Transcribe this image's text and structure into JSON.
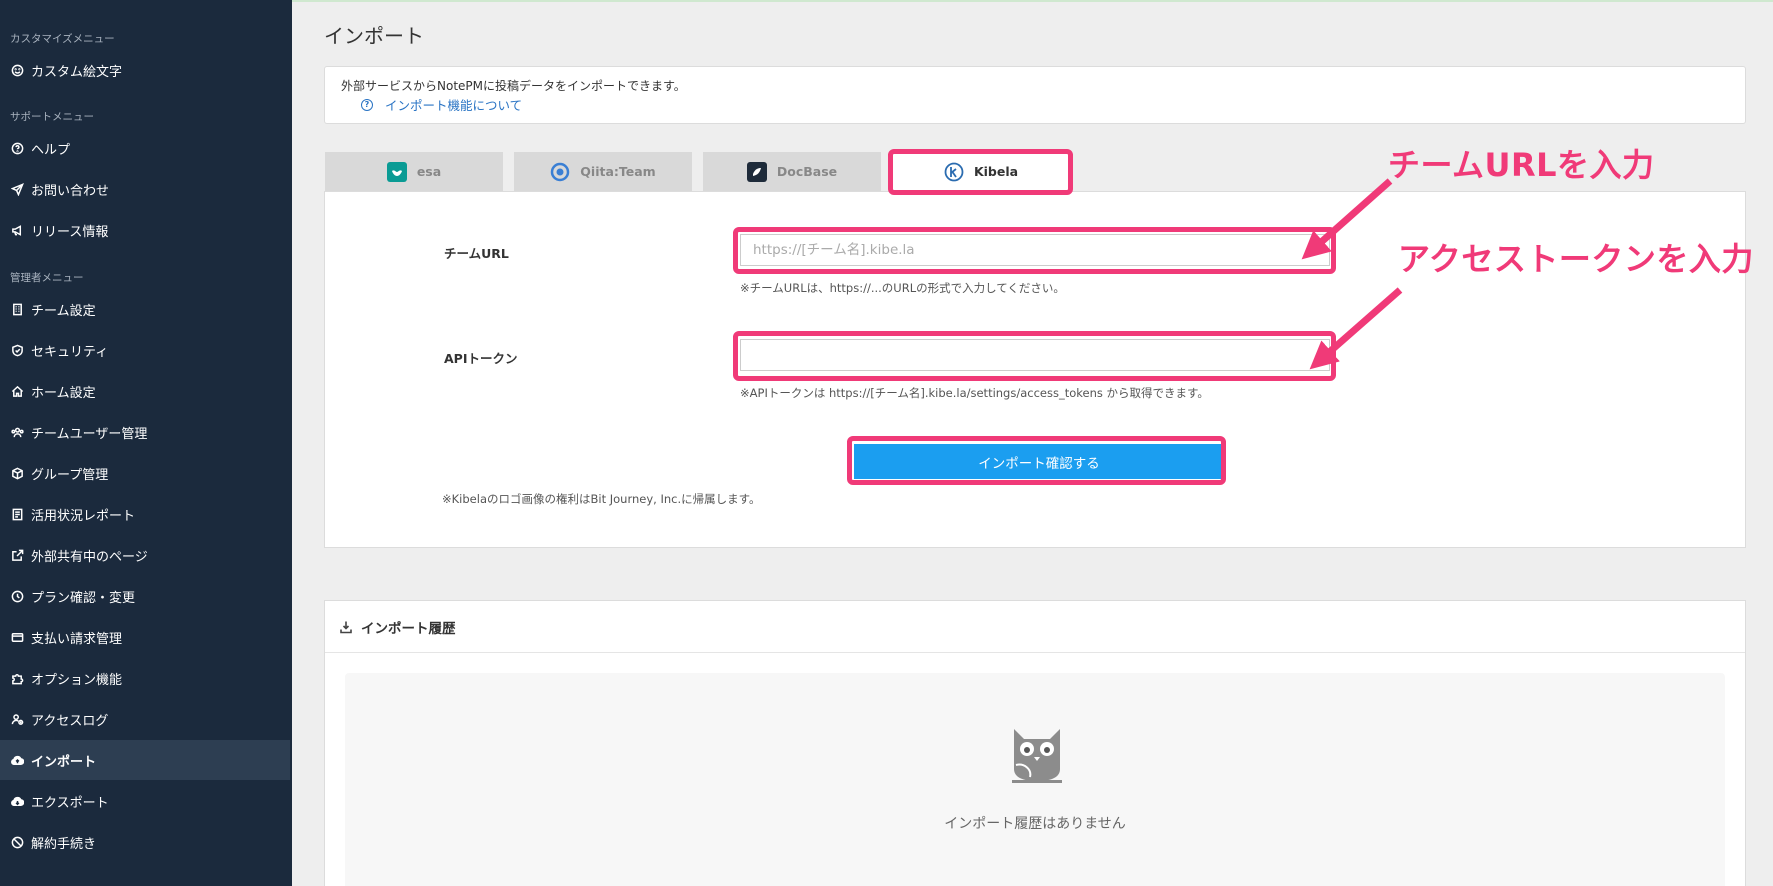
{
  "sidebar": {
    "sections": {
      "customize": "カスタマイズメニュー",
      "support": "サポートメニュー",
      "admin": "管理者メニュー"
    },
    "items": [
      {
        "label": "カスタム絵文字",
        "icon": "smile-icon"
      },
      {
        "label": "ヘルプ",
        "icon": "help-circle-icon"
      },
      {
        "label": "お問い合わせ",
        "icon": "send-icon"
      },
      {
        "label": "リリース情報",
        "icon": "megaphone-icon"
      },
      {
        "label": "チーム設定",
        "icon": "building-icon"
      },
      {
        "label": "セキュリティ",
        "icon": "shield-icon"
      },
      {
        "label": "ホーム設定",
        "icon": "home-icon"
      },
      {
        "label": "チームユーザー管理",
        "icon": "users-icon"
      },
      {
        "label": "グループ管理",
        "icon": "cube-icon"
      },
      {
        "label": "活用状況レポート",
        "icon": "report-icon"
      },
      {
        "label": "外部共有中のページ",
        "icon": "external-link-icon"
      },
      {
        "label": "プラン確認・変更",
        "icon": "plan-icon"
      },
      {
        "label": "支払い請求管理",
        "icon": "credit-card-icon"
      },
      {
        "label": "オプション機能",
        "icon": "puzzle-icon"
      },
      {
        "label": "アクセスログ",
        "icon": "user-log-icon"
      },
      {
        "label": "インポート",
        "icon": "cloud-upload-icon"
      },
      {
        "label": "エクスポート",
        "icon": "cloud-download-icon"
      },
      {
        "label": "解約手続き",
        "icon": "ban-icon"
      }
    ]
  },
  "page": {
    "title": "インポート",
    "info_text": "外部サービスからNotePMに投稿データをインポートできます。",
    "info_link": "インポート機能について"
  },
  "tabs": [
    {
      "label": "esa",
      "icon": "esa-logo-icon"
    },
    {
      "label": "Qiita:Team",
      "icon": "qiita-logo-icon"
    },
    {
      "label": "DocBase",
      "icon": "docbase-logo-icon"
    },
    {
      "label": "Kibela",
      "icon": "kibela-logo-icon"
    }
  ],
  "form": {
    "team_url_label": "チームURL",
    "team_url_placeholder": "https://[チーム名].kibe.la",
    "team_url_value": "",
    "team_url_help": "※チームURLは、https://...のURLの形式で入力してください。",
    "token_label": "APIトークン",
    "token_value": "",
    "token_help": "※APIトークンは https://[チーム名].kibe.la/settings/access_tokens から取得できます。",
    "submit_label": "インポート確認する",
    "footnote": "※Kibelaのロゴ画像の権利はBit Journey, Inc.に帰属します。"
  },
  "history": {
    "title": "インポート履歴",
    "empty_text": "インポート履歴はありません"
  },
  "annotations": {
    "team_url_note": "チームURLを入力",
    "token_note": "アクセストークンを入力",
    "highlight_color": "#f03a78"
  },
  "colors": {
    "sidebar_bg": "#1b2a3d",
    "primary_button": "#1b9ef0",
    "link": "#2a74c4"
  }
}
